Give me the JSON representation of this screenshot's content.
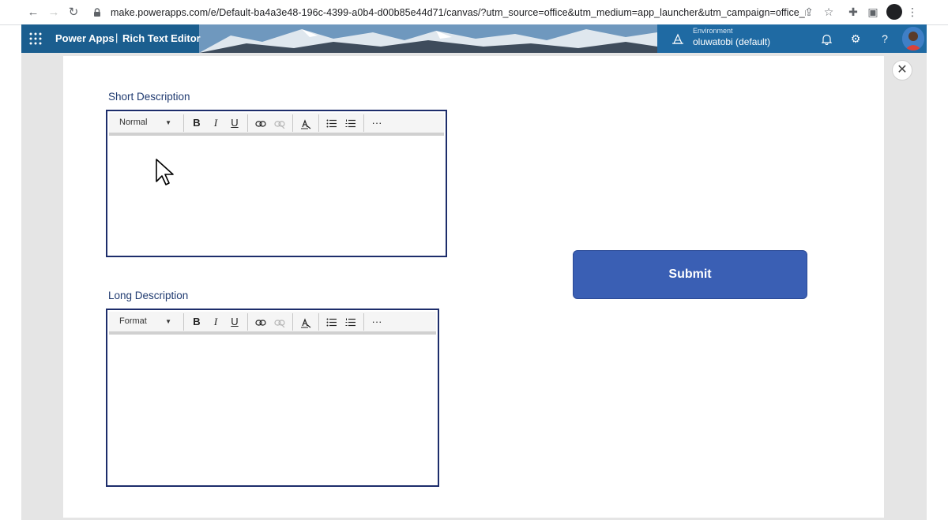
{
  "browser": {
    "url": "make.powerapps.com/e/Default-ba4a3e48-196c-4399-a0b4-d00b85e44d71/canvas/?utm_source=office&utm_medium=app_launcher&utm_campaign=office_referrals&action=n..."
  },
  "header": {
    "product": "Power Apps",
    "separator": "|",
    "app_name": "Rich Text Editor",
    "environment_label": "Environment",
    "environment_name": "oluwatobi (default)"
  },
  "short_description": {
    "label": "Short Description",
    "format_value": "Normal"
  },
  "long_description": {
    "label": "Long Description",
    "format_value": "Format"
  },
  "toolbar": {
    "bold": "B",
    "italic": "I",
    "underline": "U",
    "more": "···"
  },
  "submit": {
    "label": "Submit"
  },
  "close_icon_glyph": "✕",
  "colors": {
    "header_bg": "#1b5e8f",
    "submit_bg": "#3a5fb4",
    "editor_border": "#1d2d6b",
    "label_color": "#1f3a70"
  }
}
